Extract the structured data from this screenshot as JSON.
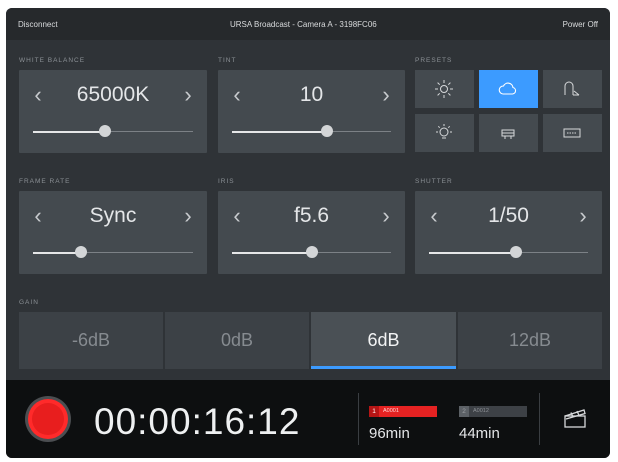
{
  "header": {
    "disconnect": "Disconnect",
    "title": "URSA Broadcast - Camera A - 3198FC06",
    "power_off": "Power Off"
  },
  "white_balance": {
    "label": "WHITE BALANCE",
    "value": "65000K",
    "level": 0.45
  },
  "tint": {
    "label": "TINT",
    "value": "10",
    "level": 0.6
  },
  "presets": {
    "label": "PRESETS",
    "items": [
      {
        "icon": "sun-icon",
        "selected": false
      },
      {
        "icon": "cloud-icon",
        "selected": true
      },
      {
        "icon": "shade-icon",
        "selected": false
      },
      {
        "icon": "bulb-icon",
        "selected": false
      },
      {
        "icon": "fluorescent-icon",
        "selected": false
      },
      {
        "icon": "custom-preset-icon",
        "selected": false
      }
    ]
  },
  "frame_rate": {
    "label": "FRAME RATE",
    "value": "Sync",
    "level": 0.3
  },
  "iris": {
    "label": "IRIS",
    "value": "f5.6",
    "level": 0.5
  },
  "shutter": {
    "label": "SHUTTER",
    "value": "1/50",
    "level": 0.55
  },
  "gain": {
    "label": "GAIN",
    "options": [
      "-6dB",
      "0dB",
      "6dB",
      "12dB"
    ],
    "selected_index": 2
  },
  "record": {
    "timecode": "00:00:16:12",
    "cards": [
      {
        "number": "1",
        "name": "A0001",
        "time": "96min",
        "active": true,
        "color": "#e52222"
      },
      {
        "number": "2",
        "name": "A0012",
        "time": "44min",
        "active": false,
        "color": "#5c6166"
      }
    ]
  },
  "colors": {
    "accent": "#3c9bff",
    "record": "#ff2a2a",
    "background": "#2f3337",
    "panel": "#444a4f"
  }
}
